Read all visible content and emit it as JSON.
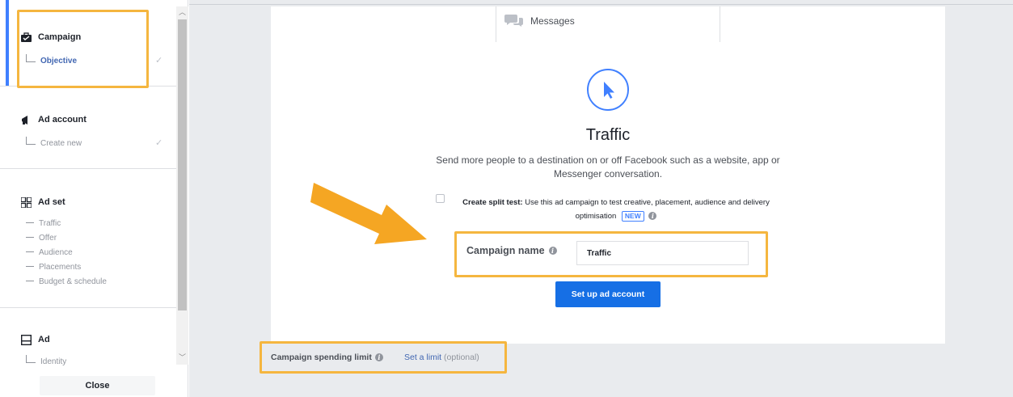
{
  "sidebar": {
    "sections": [
      {
        "title": "Campaign",
        "icon": "briefcase-icon",
        "children": [
          "Objective"
        ]
      },
      {
        "title": "Ad account",
        "icon": "megaphone-icon",
        "children": [
          "Create new"
        ]
      },
      {
        "title": "Ad set",
        "icon": "grid-icon",
        "children": [
          "Traffic",
          "Offer",
          "Audience",
          "Placements",
          "Budget & schedule"
        ]
      },
      {
        "title": "Ad",
        "icon": "ad-icon",
        "children": [
          "Identity"
        ]
      }
    ],
    "check_glyph": "✓",
    "close_label": "Close"
  },
  "main": {
    "messages_label": "Messages",
    "objective_title": "Traffic",
    "objective_desc": "Send more people to a destination on or off Facebook such as a website, app or Messenger conversation.",
    "split_test_bold": "Create split test:",
    "split_test_text": " Use this ad campaign to test creative, placement, audience and delivery optimisation",
    "new_badge": "NEW",
    "campaign_name_label": "Campaign name",
    "campaign_name_value": "Traffic",
    "setup_button": "Set up ad account",
    "spending_limit_label": "Campaign spending limit",
    "set_limit_link": "Set a limit",
    "optional_text": "(optional)",
    "info_glyph": "i"
  },
  "colors": {
    "accent_blue": "#1877f2",
    "link_blue": "#4267b2",
    "highlight_orange": "#f5b63f",
    "active_marker": "#4080ff"
  }
}
